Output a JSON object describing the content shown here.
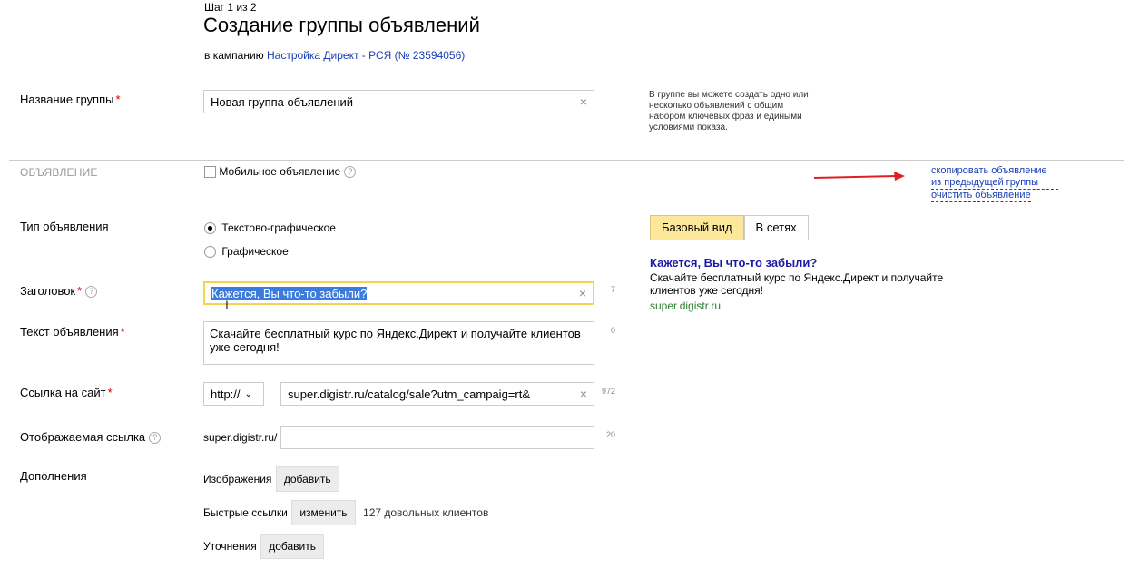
{
  "header": {
    "step": "Шаг 1 из 2",
    "title": "Создание группы объявлений",
    "campaign_prefix": "в кампанию",
    "campaign_link": "Настройка Директ - РСЯ (№ 23594056)"
  },
  "group_name": {
    "label": "Название группы",
    "required": "*",
    "value": "Новая группа объявлений",
    "clear": "×"
  },
  "hint": "В группе вы можете создать одно или несколько объявлений с общим набором ключевых фраз и едиными условиями показа.",
  "ad_section": {
    "title": "ОБЪЯВЛЕНИЕ",
    "mobile_label": "Мобильное объявление",
    "mobile_checked": false,
    "copy_link": "скопировать объявление из предыдущей группы",
    "clear_link": "очистить объявление"
  },
  "ad_type": {
    "label": "Тип объявления",
    "options": [
      "Текстово-графическое",
      "Графическое"
    ],
    "selected": "Текстово-графическое"
  },
  "headline": {
    "label": "Заголовок",
    "required": "*",
    "value": "Кажется, Вы что-то забыли?",
    "counter": "7",
    "clear": "×"
  },
  "ad_text": {
    "label": "Текст объявления",
    "required": "*",
    "value": "Скачайте бесплатный курс по Яндекс.Директ и получайте клиентов уже сегодня!",
    "counter": "0"
  },
  "site_link": {
    "label": "Ссылка на сайт",
    "required": "*",
    "protocol": "http://",
    "value": "super.digistr.ru/catalog/sale?utm_campaig=rt&",
    "counter": "972",
    "clear": "×"
  },
  "display_link": {
    "label": "Отображаемая ссылка",
    "prefix": "super.digistr.ru/",
    "value": "",
    "counter": "20"
  },
  "extras": {
    "label": "Дополнения",
    "images_label": "Изображения",
    "images_button": "добавить",
    "quicklinks_label": "Быстрые ссылки",
    "quicklinks_button": "изменить",
    "quicklinks_value": "127 довольных клиентов",
    "clarifications_label": "Уточнения",
    "clarifications_button": "добавить"
  },
  "preview": {
    "tabs": [
      "Базовый вид",
      "В сетях"
    ],
    "active_tab": "Базовый вид",
    "title": "Кажется, Вы что-то забыли?",
    "text": "Скачайте бесплатный курс по Яндекс.Директ и получайте клиентов уже сегодня!",
    "url": "super.digistr.ru"
  },
  "colors": {
    "link": "#1a3fb6",
    "required": "#cc0000",
    "active_tab": "#fde79a",
    "preview_url": "#2a7f2a",
    "arrow": "#e02020"
  }
}
